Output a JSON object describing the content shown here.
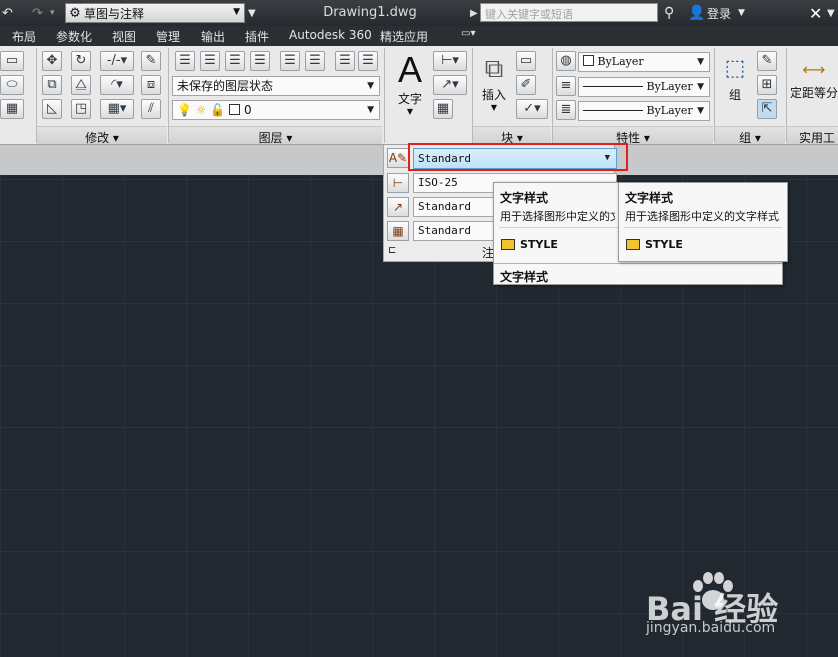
{
  "titlebar": {
    "workspace": "草图与注释",
    "document_title": "Drawing1.dwg",
    "search_placeholder": "键入关键字或短语",
    "login": "登录"
  },
  "ribbon_tabs": [
    "布局",
    "参数化",
    "视图",
    "管理",
    "输出",
    "插件",
    "Autodesk 360",
    "精选应用"
  ],
  "panels": {
    "modify": "修改",
    "layers": "图层",
    "block": "块",
    "properties": "特性",
    "group": "组",
    "utilities": "实用工"
  },
  "layer": {
    "state": "未保存的图层状态",
    "current": "0"
  },
  "tools": {
    "text": "文字",
    "insert": "插入",
    "group": "组",
    "measure": "定距等分"
  },
  "properties": {
    "color": "ByLayer",
    "linetype": "ByLayer",
    "lineweight": "ByLayer"
  },
  "annotation": {
    "text_style": "Standard",
    "dim_style": "ISO-25",
    "multileader_style": "Standard",
    "table_style": "Standard",
    "footer_label": "注"
  },
  "tooltip": {
    "title": "文字样式",
    "description": "用于选择图形中定义的文字样式",
    "command": "STYLE"
  },
  "tooltip2": {
    "title": "文字样式"
  },
  "watermark": {
    "text": "Bai 经验",
    "url": "jingyan.baidu.com"
  }
}
